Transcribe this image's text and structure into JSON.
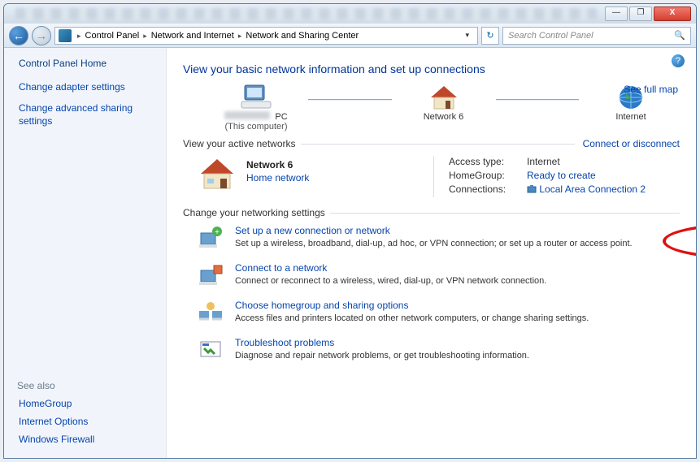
{
  "breadcrumbs": {
    "a": "Control Panel",
    "b": "Network and Internet",
    "c": "Network and Sharing Center"
  },
  "search": {
    "placeholder": "Search Control Panel"
  },
  "sidebar": {
    "home": "Control Panel Home",
    "adapter": "Change adapter settings",
    "advanced": "Change advanced sharing settings",
    "seealso_hd": "See also",
    "sa1": "HomeGroup",
    "sa2": "Internet Options",
    "sa3": "Windows Firewall"
  },
  "main": {
    "heading": "View your basic network information and set up connections",
    "fullmap": "See full map",
    "node_pc_suffix": " PC",
    "node_pc_sub": "(This computer)",
    "node_net": "Network  6",
    "node_inet": "Internet",
    "active_hd": "View your active networks",
    "connect_link": "Connect or disconnect",
    "net_name": "Network  6",
    "net_type": "Home network",
    "d_access_k": "Access type:",
    "d_access_v": "Internet",
    "d_hg_k": "HomeGroup:",
    "d_hg_v": "Ready to create",
    "d_conn_k": "Connections:",
    "d_conn_v": "Local Area Connection 2",
    "change_hd": "Change your networking settings",
    "t1_t": "Set up a new connection or network",
    "t1_d": "Set up a wireless, broadband, dial-up, ad hoc, or VPN connection; or set up a router or access point.",
    "t2_t": "Connect to a network",
    "t2_d": "Connect or reconnect to a wireless, wired, dial-up, or VPN network connection.",
    "t3_t": "Choose homegroup and sharing options",
    "t3_d": "Access files and printers located on other network computers, or change sharing settings.",
    "t4_t": "Troubleshoot problems",
    "t4_d": "Diagnose and repair network problems, or get troubleshooting information."
  }
}
